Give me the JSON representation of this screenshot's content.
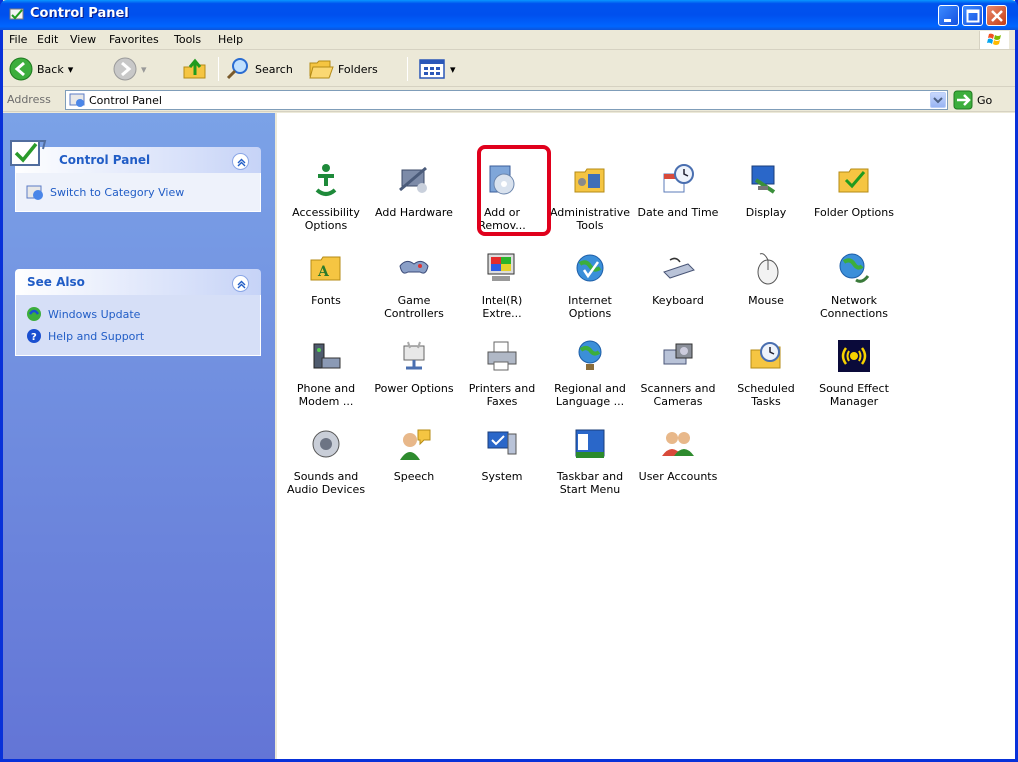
{
  "window": {
    "title": "Control Panel"
  },
  "menu": [
    "File",
    "Edit",
    "View",
    "Favorites",
    "Tools",
    "Help"
  ],
  "toolbar": {
    "back": "Back",
    "search": "Search",
    "folders": "Folders"
  },
  "address": {
    "label": "Address",
    "value": "Control Panel",
    "go": "Go"
  },
  "taskpane": {
    "control_panel": {
      "title": "Control Panel",
      "link": "Switch to Category View"
    },
    "see_also": {
      "title": "See Also",
      "links": [
        "Windows Update",
        "Help and Support"
      ]
    }
  },
  "items": [
    [
      "Accessibility",
      "Options"
    ],
    [
      "Add Hardware",
      ""
    ],
    [
      "Add or",
      "Remov..."
    ],
    [
      "Administrative",
      "Tools"
    ],
    [
      "Date and Time",
      ""
    ],
    [
      "Display",
      ""
    ],
    [
      "Folder Options",
      ""
    ],
    [
      "Fonts",
      ""
    ],
    [
      "Game",
      "Controllers"
    ],
    [
      "Intel(R)",
      "Extre..."
    ],
    [
      "Internet",
      "Options"
    ],
    [
      "Keyboard",
      ""
    ],
    [
      "Mouse",
      ""
    ],
    [
      "Network",
      "Connections"
    ],
    [
      "Phone and",
      "Modem ..."
    ],
    [
      "Power Options",
      ""
    ],
    [
      "Printers and",
      "Faxes"
    ],
    [
      "Regional and",
      "Language ..."
    ],
    [
      "Scanners and",
      "Cameras"
    ],
    [
      "Scheduled",
      "Tasks"
    ],
    [
      "Sound Effect",
      "Manager"
    ],
    [
      "Sounds and",
      "Audio Devices"
    ],
    [
      "Speech",
      ""
    ],
    [
      "System",
      ""
    ],
    [
      "Taskbar and",
      "Start Menu"
    ],
    [
      "User Accounts",
      ""
    ]
  ],
  "colors": {
    "titlebar": "#0058ee",
    "taskpane": "#6f8ee0",
    "highlight": "#e0001c"
  }
}
